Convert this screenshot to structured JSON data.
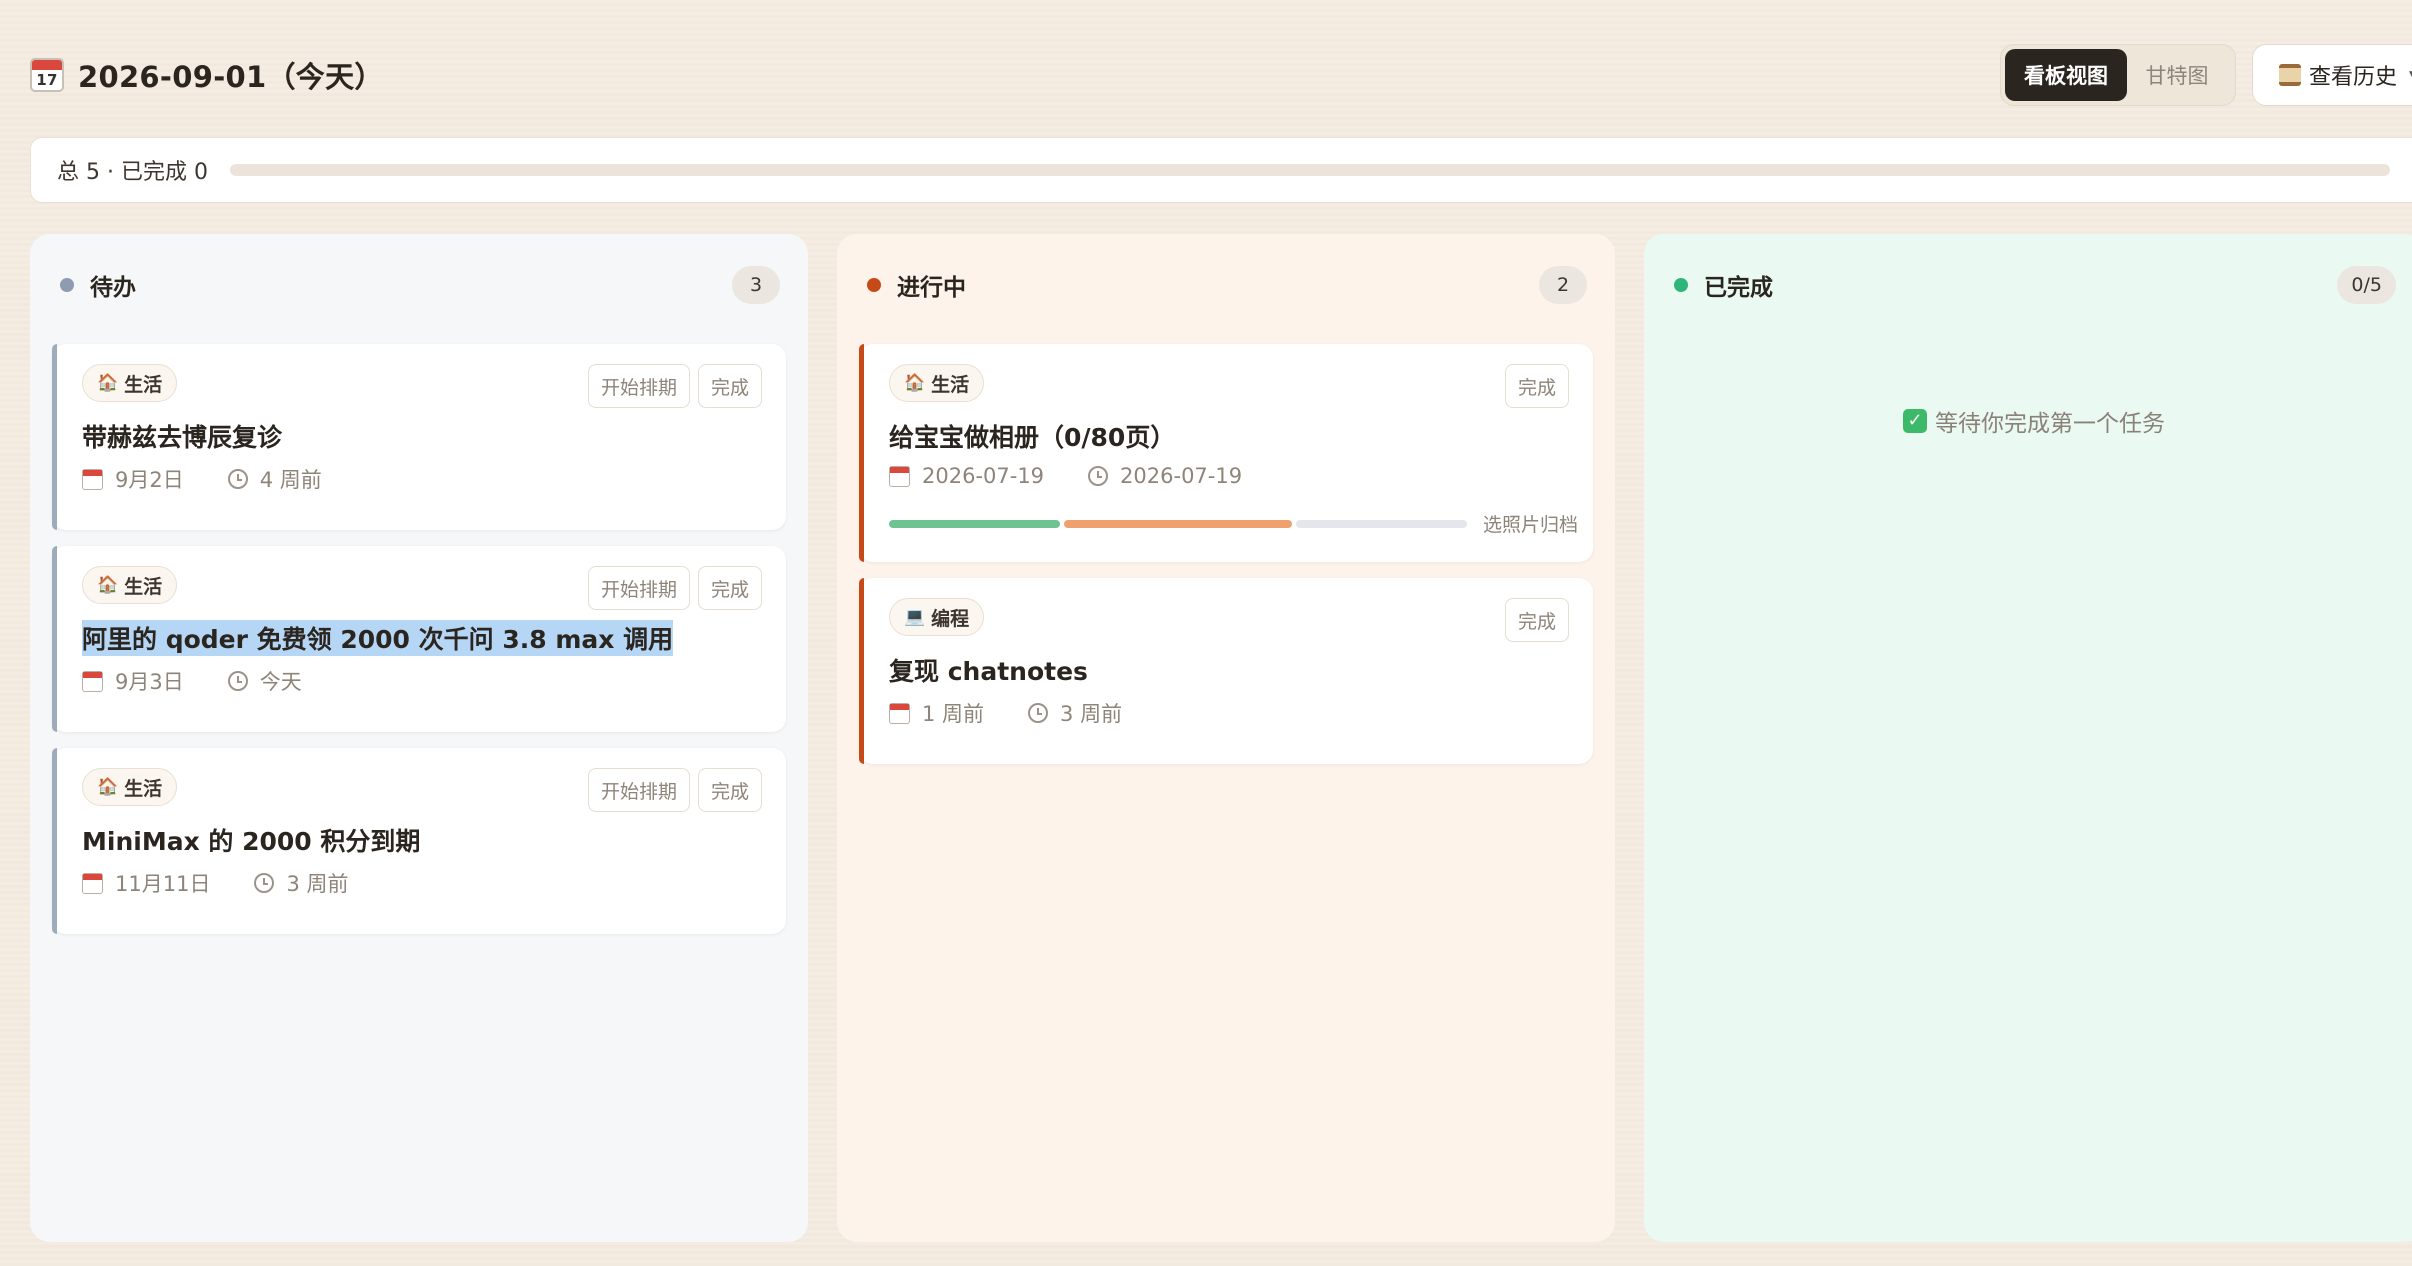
{
  "header": {
    "date_title": "2026-09-01（今天）",
    "calendar_day": "17",
    "views": {
      "board": "看板视图",
      "gantt": "甘特图",
      "active": "board"
    },
    "history_label": "查看历史"
  },
  "summary": {
    "text": "总 5 · 已完成 0",
    "progress": 0
  },
  "columns": [
    {
      "title": "待办",
      "count": "3",
      "dot_color": "#8e9bb0",
      "cards": [
        {
          "tag": "生活",
          "tag_icon": "house-icon",
          "actions": [
            "开始排期",
            "完成"
          ],
          "title": "带赫兹去博辰复诊",
          "date": "9月2日",
          "ago": "4 周前"
        },
        {
          "tag": "生活",
          "tag_icon": "house-icon",
          "actions": [
            "开始排期",
            "完成"
          ],
          "title": "阿里的 qoder 免费领 2000 次千问 3.8 max 调用",
          "date": "9月3日",
          "ago": "今天",
          "selected": true
        },
        {
          "tag": "生活",
          "tag_icon": "house-icon",
          "actions": [
            "开始排期",
            "完成"
          ],
          "title": "MiniMax 的 2000 积分到期",
          "date": "11月11日",
          "ago": "3 周前"
        }
      ]
    },
    {
      "title": "进行中",
      "count": "2",
      "dot_color": "#c64a17",
      "cards": [
        {
          "tag": "生活",
          "tag_icon": "house-icon",
          "actions": [
            "完成"
          ],
          "title": "给宝宝做相册（0/80页）",
          "date": "2026-07-19",
          "ago": "2026-07-19",
          "subtasks": {
            "label": "选照片归档",
            "segments": [
              {
                "color": "#6fc392",
                "fraction": 0.3
              },
              {
                "color": "#f0a06e",
                "fraction": 0.4
              },
              {
                "color": "#e3e6eb",
                "fraction": 0.3
              }
            ]
          }
        },
        {
          "tag": "编程",
          "tag_icon": "laptop-icon",
          "actions": [
            "完成"
          ],
          "title": "复现 chatnotes",
          "date": "1 周前",
          "ago": "3 周前"
        }
      ]
    },
    {
      "title": "已完成",
      "count": "0/5",
      "dot_color": "#2fb57a",
      "empty_text": "等待你完成第一个任务"
    }
  ]
}
